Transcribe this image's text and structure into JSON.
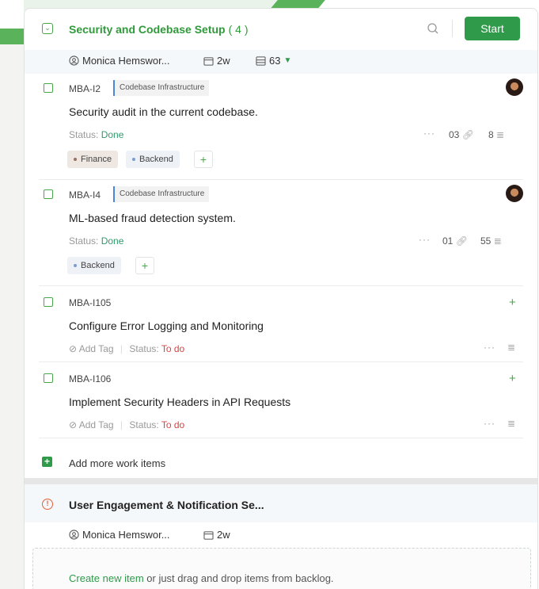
{
  "sprint1": {
    "title": "Security and Codebase Setup",
    "count": "( 4 )",
    "start_label": "Start",
    "owner": "Monica Hemswor...",
    "duration": "2w",
    "points": "63"
  },
  "items": [
    {
      "id": "MBA-I2",
      "project": "Codebase Infrastructure",
      "title": "Security audit in the current codebase.",
      "status_label": "Status:",
      "status_value": "Done",
      "links": "03",
      "subtasks": "8",
      "tags": [
        "Finance",
        "Backend"
      ]
    },
    {
      "id": "MBA-I4",
      "project": "Codebase Infrastructure",
      "title": "ML-based fraud detection system.",
      "status_label": "Status:",
      "status_value": "Done",
      "links": "01",
      "subtasks": "55",
      "tags": [
        "Backend"
      ]
    },
    {
      "id": "MBA-I105",
      "title": "Configure Error Logging and Monitoring",
      "add_tag": "Add Tag",
      "status_label": "Status:",
      "status_value": "To do"
    },
    {
      "id": "MBA-I106",
      "title": "Implement Security Headers in API Requests",
      "add_tag": "Add Tag",
      "status_label": "Status:",
      "status_value": "To do"
    }
  ],
  "add_more_label": "Add more work items",
  "sprint2": {
    "title": "User Engagement & Notification Se...",
    "owner": "Monica Hemswor...",
    "duration": "2w"
  },
  "drop_zone": {
    "link": "Create new item",
    "text": " or just drag and drop items from backlog."
  },
  "colors": {
    "accent": "#2f9a4a",
    "done": "#2f9a6a",
    "todo": "#e04040"
  }
}
